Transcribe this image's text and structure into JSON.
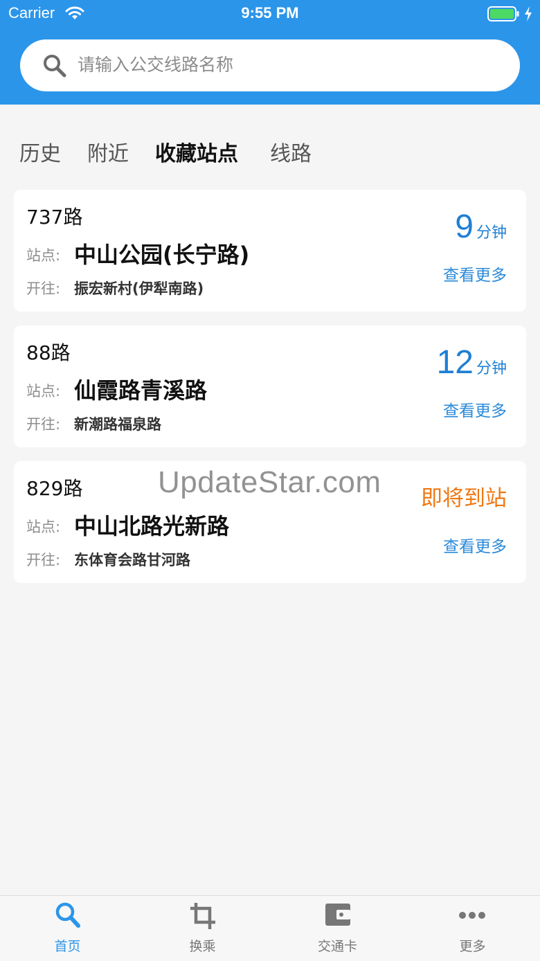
{
  "status_bar": {
    "carrier": "Carrier",
    "time": "9:55 PM"
  },
  "search": {
    "placeholder": "请输入公交线路名称"
  },
  "tabs": [
    {
      "label": "历史",
      "active": false
    },
    {
      "label": "附近",
      "active": false
    },
    {
      "label": "收藏站点",
      "active": true
    },
    {
      "label": "线路",
      "active": false
    }
  ],
  "labels": {
    "stop": "站点:",
    "direction": "开往:",
    "more": "查看更多"
  },
  "cards": [
    {
      "route": "737路",
      "stop": "中山公园(长宁路)",
      "direction": "振宏新村(伊犁南路)",
      "eta_value": "9",
      "eta_unit": "分钟"
    },
    {
      "route": "88路",
      "stop": "仙霞路青溪路",
      "direction": "新潮路福泉路",
      "eta_value": "12",
      "eta_unit": "分钟"
    },
    {
      "route": "829路",
      "stop": "中山北路光新路",
      "direction": "东体育会路甘河路",
      "eta_text": "即将到站"
    }
  ],
  "watermark": "UpdateStar.com",
  "tabbar": [
    {
      "label": "首页",
      "icon": "search-icon",
      "active": true
    },
    {
      "label": "换乘",
      "icon": "crop-icon",
      "active": false
    },
    {
      "label": "交通卡",
      "icon": "wallet-icon",
      "active": false
    },
    {
      "label": "更多",
      "icon": "more-icon",
      "active": false
    }
  ],
  "colors": {
    "header": "#2b95ea",
    "eta_blue": "#1f7fd4",
    "arriving_orange": "#ef7813",
    "link_blue": "#2a8ad9"
  }
}
